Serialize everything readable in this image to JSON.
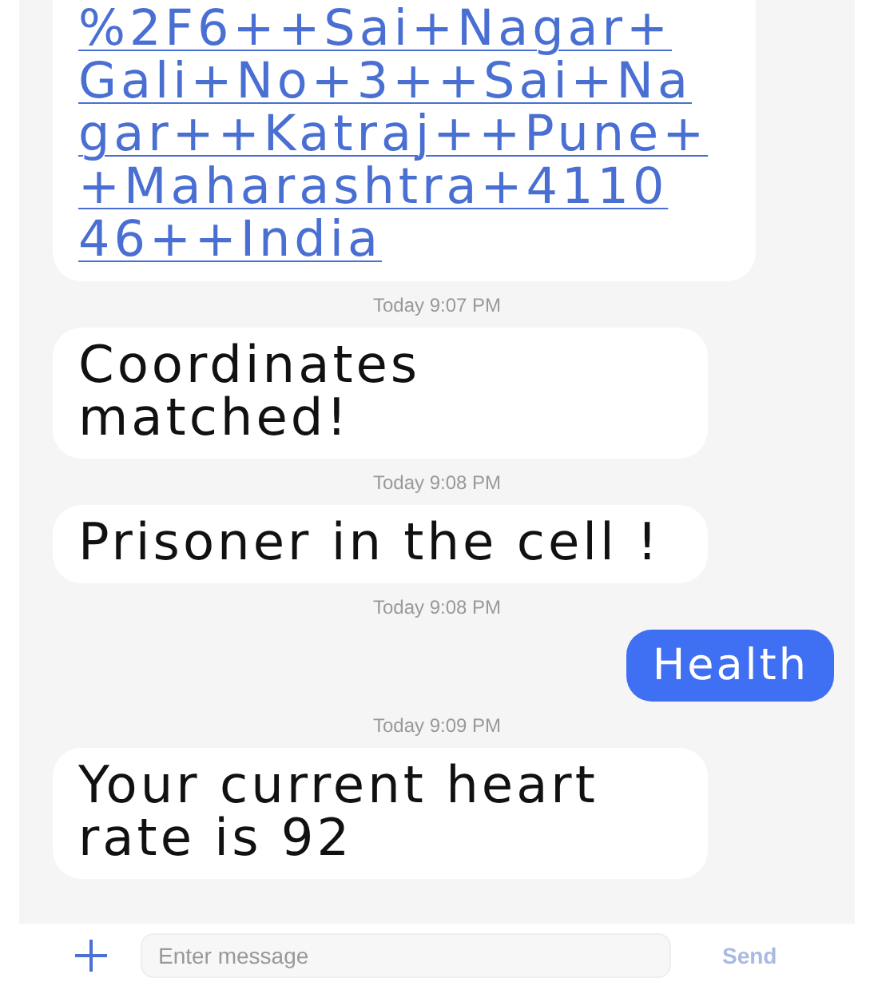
{
  "messages": [
    {
      "kind": "link",
      "outgoing": false,
      "lines": [
        "%2F6++Sai+Nagar+",
        "Gali+No+3++Sai+Na",
        "gar++Katraj++Pune+",
        "+Maharashtra+4110",
        "46++India"
      ],
      "time": "Today 9:07 PM"
    },
    {
      "kind": "text",
      "outgoing": false,
      "text": "Coordinates matched!",
      "time": "Today 9:08 PM"
    },
    {
      "kind": "text",
      "outgoing": false,
      "text": "Prisoner in the cell !",
      "time": "Today 9:08 PM"
    },
    {
      "kind": "text",
      "outgoing": true,
      "text": "Health",
      "time": "Today 9:09 PM"
    },
    {
      "kind": "text",
      "outgoing": false,
      "text": "Your current heart rate is 92"
    }
  ],
  "composer": {
    "placeholder": "Enter message",
    "send": "Send"
  }
}
